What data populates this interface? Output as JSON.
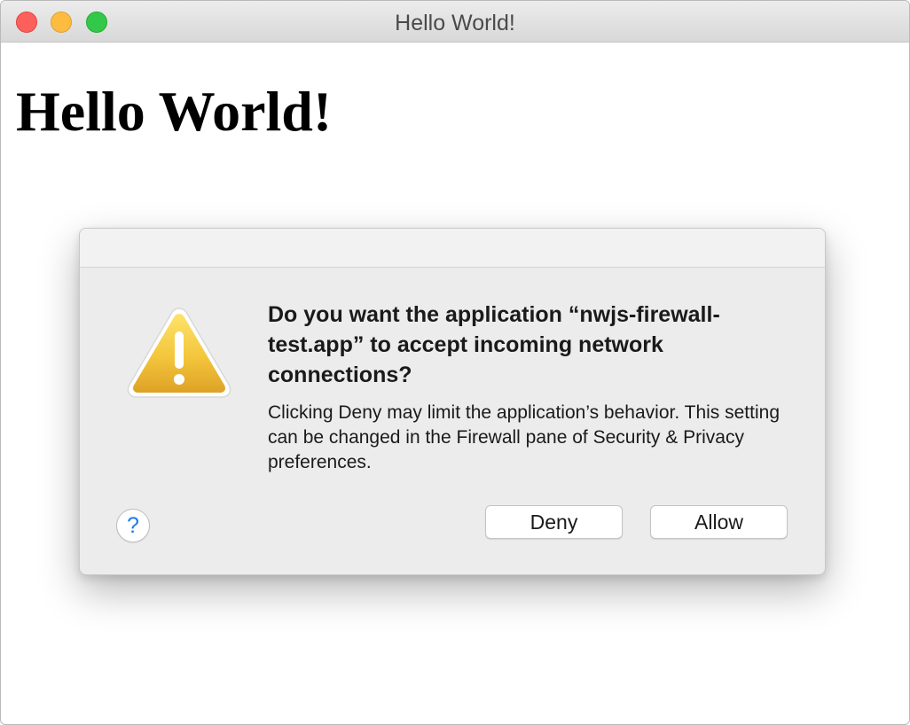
{
  "window": {
    "title": "Hello World!"
  },
  "page": {
    "heading": "Hello World!"
  },
  "dialog": {
    "icon": "warning-icon",
    "heading": "Do you want the application “nwjs-firewall-test.app” to accept incoming network connections?",
    "body": "Clicking Deny may limit the application’s behavior. This setting can be changed in the Firewall pane of Security & Privacy preferences.",
    "help_label": "?",
    "deny_label": "Deny",
    "allow_label": "Allow"
  },
  "colors": {
    "close": "#fc605c",
    "minimize": "#fdbc40",
    "zoom": "#34c84a",
    "help_accent": "#1d7ce8",
    "warning_fill": "#f1c232"
  }
}
